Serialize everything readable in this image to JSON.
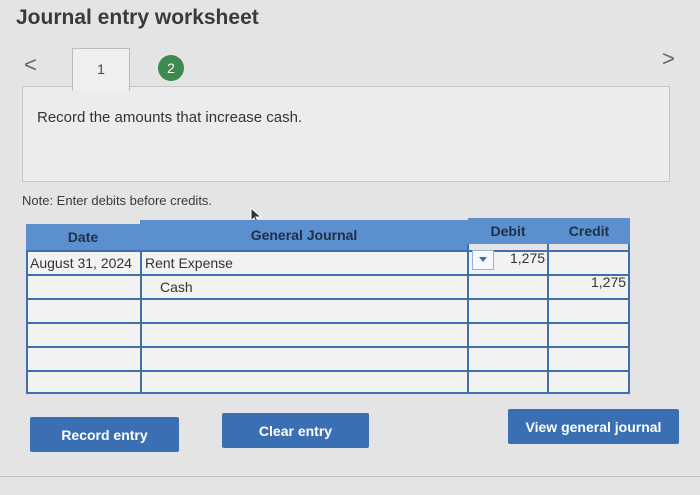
{
  "header": {
    "title": "Journal entry worksheet"
  },
  "nav": {
    "prev": "<",
    "next": ">"
  },
  "tabs": [
    {
      "label": "1"
    },
    {
      "label": "2"
    }
  ],
  "prompt": {
    "text": "Record the amounts that increase cash."
  },
  "note": {
    "text": "Note: Enter debits before credits."
  },
  "journal": {
    "columns": {
      "date": "Date",
      "account": "General Journal",
      "debit": "Debit",
      "credit": "Credit"
    },
    "rows": [
      {
        "date": "August 31, 2024",
        "account": "Rent Expense",
        "debit": "1,275",
        "credit": ""
      },
      {
        "date": "",
        "account": "Cash",
        "debit": "",
        "credit": "1,275"
      }
    ]
  },
  "buttons": {
    "record": "Record entry",
    "clear": "Clear entry",
    "view": "View general journal"
  },
  "colors": {
    "header_blue": "#5b8fcd",
    "grid_blue": "#3f70ad",
    "button_blue": "#3a6fb3",
    "tab_green": "#3d8a4e"
  }
}
